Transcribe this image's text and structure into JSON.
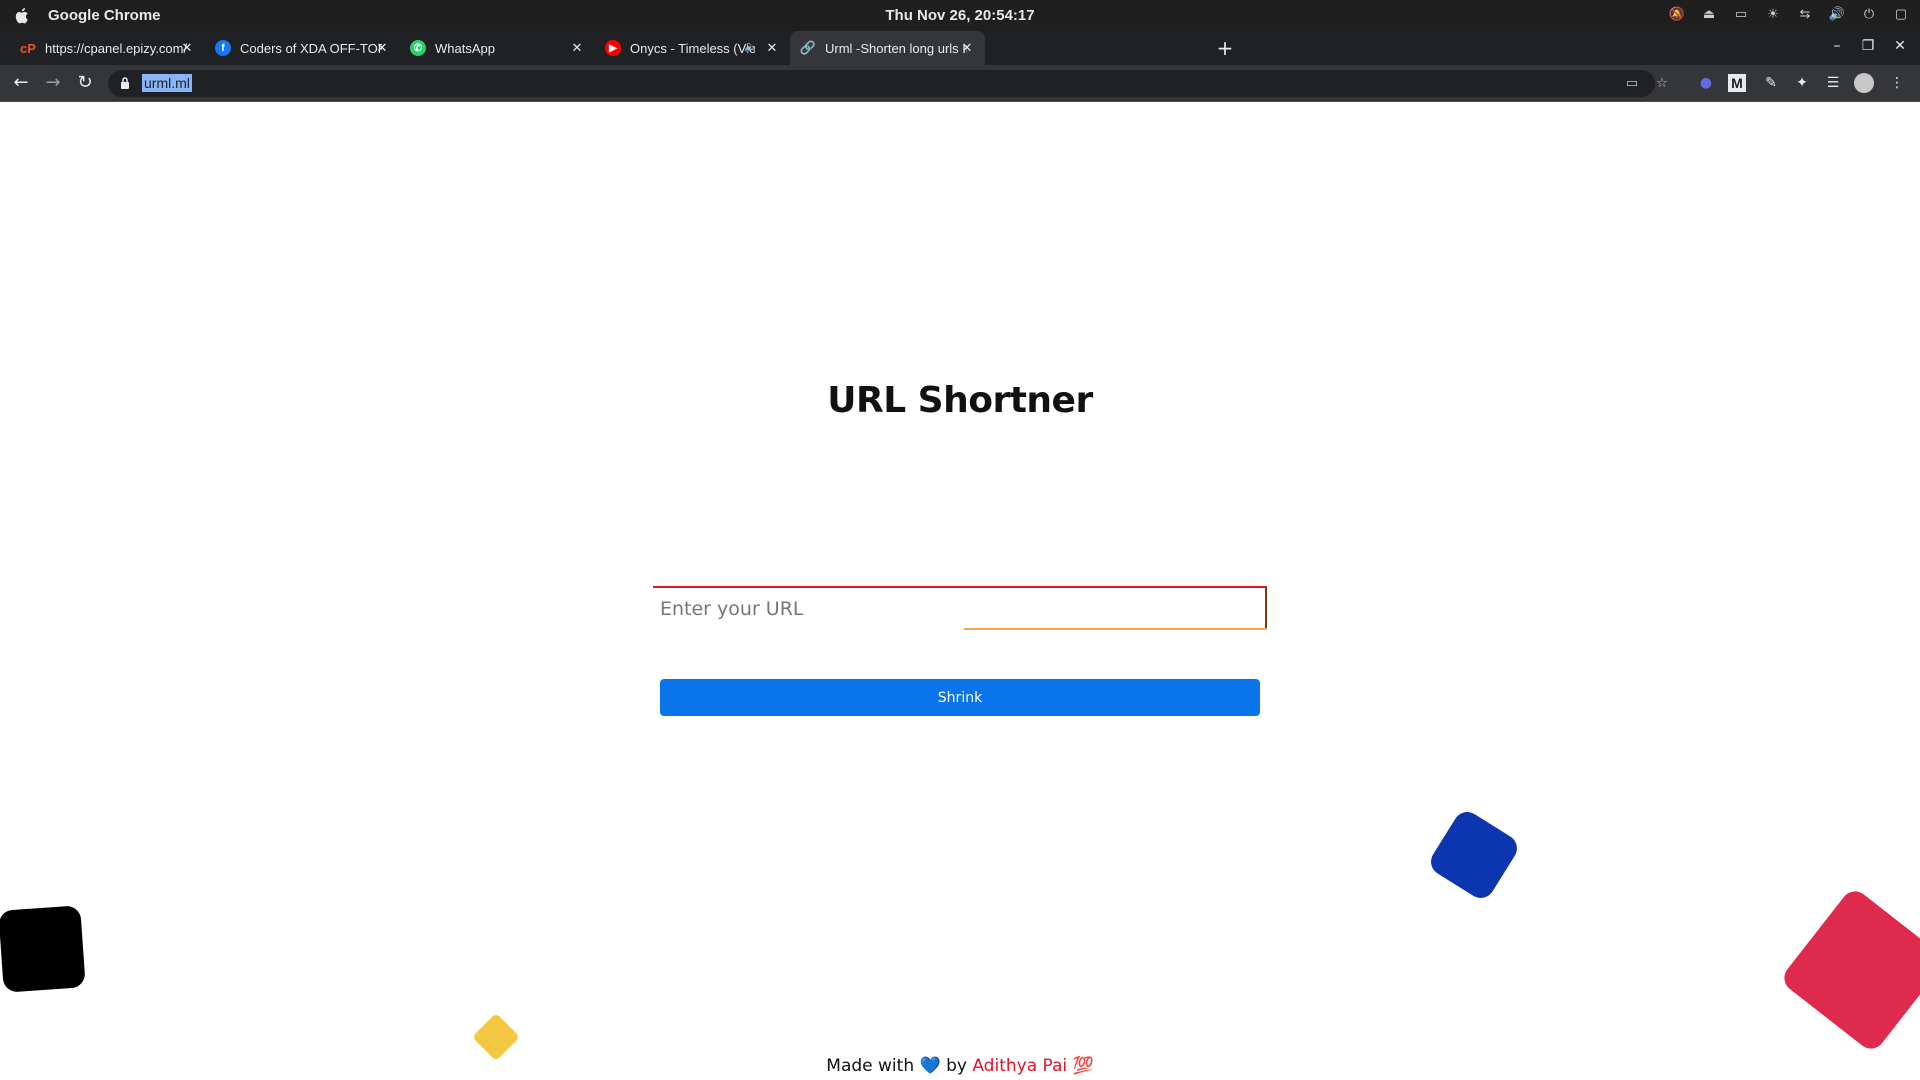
{
  "os_bar": {
    "app_name": "Google Chrome",
    "clock": "Thu Nov 26, 20:54:17"
  },
  "tabs": [
    {
      "title": "https://cpanel.epizy.com/panel",
      "favicon": "cpanel-icon",
      "color": "#f0552a"
    },
    {
      "title": "Coders of XDA OFF-TOPIC GROUP",
      "favicon": "facebook-icon",
      "color": "#1877f2"
    },
    {
      "title": "WhatsApp",
      "favicon": "whatsapp-icon",
      "color": "#25d366"
    },
    {
      "title": "Onycs - Timeless (Vlog No",
      "favicon": "youtube-music-icon",
      "color": "#ff0000"
    },
    {
      "title": "Urml -Shorten long urls Instantly",
      "favicon": "link-icon",
      "color": "#8ab4f8"
    }
  ],
  "address_bar": {
    "url": "urml.ml"
  },
  "page": {
    "title": "URL Shortner",
    "input_placeholder": "Enter your URL",
    "button_label": "Shrink",
    "footer_prefix": "Made with",
    "footer_heart": "💙",
    "footer_by": "by",
    "footer_author": "Adithya Pai",
    "footer_emoji": "💯"
  },
  "colors": {
    "accent_blue": "#0a75eb",
    "author_red": "#e0132b"
  }
}
